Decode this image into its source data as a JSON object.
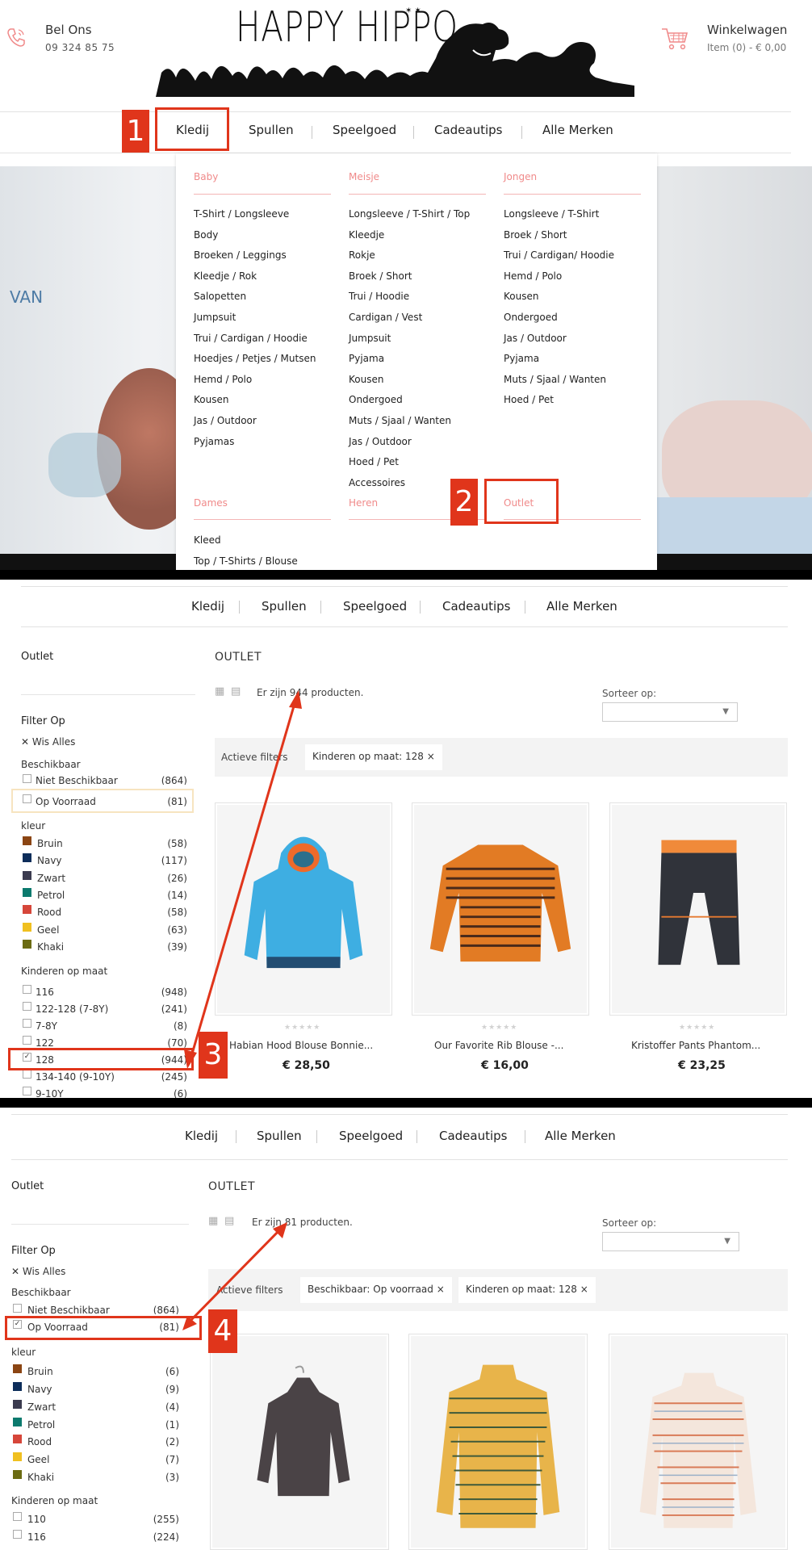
{
  "header": {
    "call_label": "Bel Ons",
    "phone": "09 324 85 75",
    "logo_text": "HAPPY HIPPO",
    "cart_label": "Winkelwagen",
    "cart_summary": "Item (0) - € 0,00"
  },
  "nav": {
    "items": [
      "Kledij",
      "Spullen",
      "Speelgoed",
      "Cadeautips",
      "Alle Merken"
    ]
  },
  "hero": {
    "text": "VAN"
  },
  "megamenu": {
    "columns": [
      {
        "title": "Baby",
        "items": [
          "T-Shirt / Longsleeve",
          "Body",
          "Broeken / Leggings",
          "Kleedje / Rok",
          "Salopetten",
          "Jumpsuit",
          "Trui / Cardigan / Hoodie",
          "Hoedjes / Petjes / Mutsen",
          "Hemd / Polo",
          "Kousen",
          "Jas / Outdoor",
          "Pyjamas"
        ]
      },
      {
        "title": "Meisje",
        "items": [
          "Longsleeve / T-Shirt / Top",
          "Kleedje",
          "Rokje",
          "Broek / Short",
          "Trui / Hoodie",
          "Cardigan / Vest",
          "Jumpsuit",
          "Pyjama",
          "Kousen",
          "Ondergoed",
          "Muts / Sjaal / Wanten",
          "Jas / Outdoor",
          "Hoed / Pet",
          "Accessoires"
        ]
      },
      {
        "title": "Jongen",
        "items": [
          "Longsleeve / T-Shirt",
          "Broek / Short",
          "Trui / Cardigan/ Hoodie",
          "Hemd / Polo",
          "Kousen",
          "Ondergoed",
          "Jas / Outdoor",
          "Pyjama",
          "Muts / Sjaal / Wanten",
          "Hoed / Pet"
        ]
      }
    ],
    "bottom_sections": [
      {
        "title": "Dames",
        "items": [
          "Kleed",
          "Top / T-Shirts / Blouse"
        ]
      },
      {
        "title": "Heren",
        "items": []
      },
      {
        "title": "Outlet",
        "items": []
      }
    ]
  },
  "steps": [
    "1",
    "2",
    "3",
    "4"
  ],
  "panel2": {
    "category": "Outlet",
    "filter_title": "Filter Op",
    "clear_all": "Wis Alles",
    "availability_title": "Beschikbaar",
    "availability": [
      {
        "label": "Niet Beschikbaar",
        "count": "(864)"
      },
      {
        "label": "Op Voorraad",
        "count": "(81)"
      }
    ],
    "color_title": "kleur",
    "colors": [
      {
        "label": "Bruin",
        "count": "(58)",
        "color": "#8b4513"
      },
      {
        "label": "Navy",
        "count": "(117)",
        "color": "#0d2d5a"
      },
      {
        "label": "Zwart",
        "count": "(26)",
        "color": "#3b3b4f"
      },
      {
        "label": "Petrol",
        "count": "(14)",
        "color": "#0b7a6e"
      },
      {
        "label": "Rood",
        "count": "(58)",
        "color": "#d6463a"
      },
      {
        "label": "Geel",
        "count": "(63)",
        "color": "#f0c020"
      },
      {
        "label": "Khaki",
        "count": "(39)",
        "color": "#6b6b12"
      }
    ],
    "size_title": "Kinderen op maat",
    "sizes": [
      {
        "label": "116",
        "count": "(948)",
        "checked": false
      },
      {
        "label": "122-128 (7-8Y)",
        "count": "(241)",
        "checked": false
      },
      {
        "label": "7-8Y",
        "count": "(8)",
        "checked": false
      },
      {
        "label": "122",
        "count": "(70)",
        "checked": false
      },
      {
        "label": "128",
        "count": "(944)",
        "checked": true
      },
      {
        "label": "134-140 (9-10Y)",
        "count": "(245)",
        "checked": false
      },
      {
        "label": "9-10Y",
        "count": "(6)",
        "checked": false
      }
    ],
    "page_title": "OUTLET",
    "result_count": "Er zijn 944 producten.",
    "sort_label": "Sorteer op:",
    "active_filters_label": "Actieve filters",
    "active_filters": [
      "Kinderen op maat: 128 ×"
    ],
    "products": [
      {
        "name": "Habian Hood Blouse Bonnie...",
        "price": "€ 28,50"
      },
      {
        "name": "Our Favorite Rib Blouse -...",
        "price": "€ 16,00"
      },
      {
        "name": "Kristoffer Pants Phantom...",
        "price": "€ 23,25"
      }
    ]
  },
  "panel3": {
    "category": "Outlet",
    "filter_title": "Filter Op",
    "clear_all": "Wis Alles",
    "availability_title": "Beschikbaar",
    "availability": [
      {
        "label": "Niet Beschikbaar",
        "count": "(864)",
        "checked": false
      },
      {
        "label": "Op Voorraad",
        "count": "(81)",
        "checked": true
      }
    ],
    "color_title": "kleur",
    "colors": [
      {
        "label": "Bruin",
        "count": "(6)",
        "color": "#8b4513"
      },
      {
        "label": "Navy",
        "count": "(9)",
        "color": "#0d2d5a"
      },
      {
        "label": "Zwart",
        "count": "(4)",
        "color": "#3b3b4f"
      },
      {
        "label": "Petrol",
        "count": "(1)",
        "color": "#0b7a6e"
      },
      {
        "label": "Rood",
        "count": "(2)",
        "color": "#d6463a"
      },
      {
        "label": "Geel",
        "count": "(7)",
        "color": "#f0c020"
      },
      {
        "label": "Khaki",
        "count": "(3)",
        "color": "#6b6b12"
      }
    ],
    "size_title": "Kinderen op maat",
    "sizes": [
      {
        "label": "110",
        "count": "(255)"
      },
      {
        "label": "116",
        "count": "(224)"
      }
    ],
    "page_title": "OUTLET",
    "result_count": "Er zijn 81 producten.",
    "sort_label": "Sorteer op:",
    "active_filters_label": "Actieve filters",
    "active_filters": [
      "Beschikbaar: Op voorraad ×",
      "Kinderen op maat: 128 ×"
    ]
  },
  "colors": {
    "annotation_red": "#e0351b",
    "accent_pink": "#f08a8a"
  }
}
